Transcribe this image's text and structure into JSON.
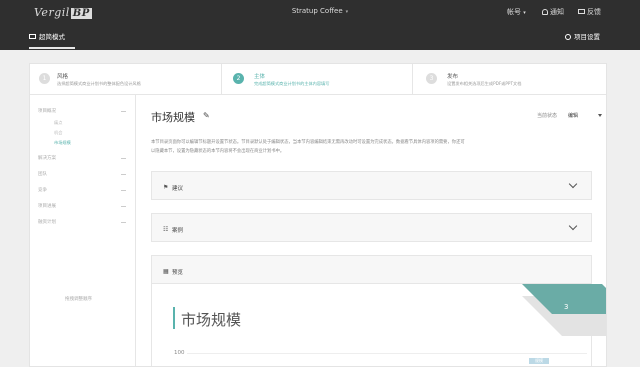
{
  "header": {
    "logo_text": "Vergil",
    "logo_mark": "BP",
    "project_name": "Stratup Coffee",
    "account_label": "帐号",
    "notify_label": "通知",
    "feedback_label": "反馈",
    "mode_label": "超简模式",
    "settings_label": "项目设置"
  },
  "steps": [
    {
      "number": "1",
      "title": "风格",
      "description": "选择超简模式商业计划书的整体配色设计风格"
    },
    {
      "number": "2",
      "title": "主体",
      "description": "完成超简模式商业计划书的主体内容填写"
    },
    {
      "number": "3",
      "title": "发布",
      "description": "设置发布相关选项后生成PDF或PPT文档"
    }
  ],
  "sidebar": {
    "items": [
      {
        "label": "项目概况"
      },
      {
        "label": "解决方案"
      },
      {
        "label": "团队"
      },
      {
        "label": "竞争"
      },
      {
        "label": "项目进展"
      },
      {
        "label": "融资计划"
      }
    ],
    "sub_items": [
      {
        "label": "痛点"
      },
      {
        "label": "机会"
      },
      {
        "label": "市场规模"
      }
    ],
    "hint": "拖拽调整顺序"
  },
  "content": {
    "title": "市场规模",
    "status_label": "当前状态",
    "status_value": "编辑",
    "intro_line_1": "本节目录页面你可以编辑节标题开设置节状态。节目录默认处于编辑状态，当本节内容编辑结束无需再改动时可设置为完成状态。数据看节具体内容项的需要，你还可",
    "intro_line_2": "以隐藏本节，设置为隐藏状态的本节内容将不会出现在商业计划书中。",
    "panels": [
      {
        "icon": "⚑",
        "label": "建议"
      },
      {
        "icon": "☷",
        "label": "案例"
      }
    ],
    "preview_label": "预览"
  },
  "preview": {
    "title": "市场规模",
    "badge_number": "3",
    "axis_tick": "100",
    "legend_text": "规模"
  },
  "colors": {
    "accent": "#59b3ad",
    "topbar": "#2f2f2f"
  }
}
